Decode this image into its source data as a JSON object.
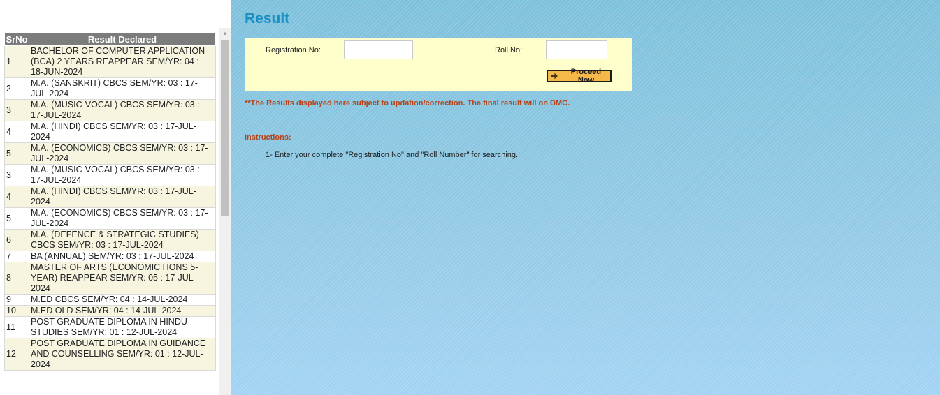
{
  "results_table": {
    "headers": {
      "srno": "SrNo",
      "result": "Result Declared"
    },
    "rows": [
      {
        "srno": "1",
        "result": "BACHELOR OF COMPUTER APPLICATION (BCA) 2 YEARS REAPPEAR SEM/YR: 04 : 18-JUN-2024"
      },
      {
        "srno": "2",
        "result": "M.A. (SANSKRIT) CBCS SEM/YR: 03 : 17-JUL-2024"
      },
      {
        "srno": "3",
        "result": "M.A. (MUSIC-VOCAL) CBCS SEM/YR: 03 : 17-JUL-2024"
      },
      {
        "srno": "4",
        "result": "M.A. (HINDI) CBCS SEM/YR: 03 : 17-JUL-2024"
      },
      {
        "srno": "5",
        "result": "M.A. (ECONOMICS) CBCS SEM/YR: 03 : 17-JUL-2024"
      },
      {
        "srno": "3",
        "result": "M.A. (MUSIC-VOCAL) CBCS SEM/YR: 03 : 17-JUL-2024"
      },
      {
        "srno": "4",
        "result": "M.A. (HINDI) CBCS SEM/YR: 03 : 17-JUL-2024"
      },
      {
        "srno": "5",
        "result": "M.A. (ECONOMICS) CBCS SEM/YR: 03 : 17-JUL-2024"
      },
      {
        "srno": "6",
        "result": "M.A. (DEFENCE & STRATEGIC STUDIES) CBCS SEM/YR: 03 : 17-JUL-2024"
      },
      {
        "srno": "7",
        "result": "BA (ANNUAL) SEM/YR: 03 : 17-JUL-2024"
      },
      {
        "srno": "8",
        "result": "MASTER OF ARTS (ECONOMIC HONS 5-YEAR) REAPPEAR SEM/YR: 05 : 17-JUL-2024"
      },
      {
        "srno": "9",
        "result": "M.ED CBCS SEM/YR: 04 : 14-JUL-2024"
      },
      {
        "srno": "10",
        "result": "M.ED OLD SEM/YR: 04 : 14-JUL-2024"
      },
      {
        "srno": "11",
        "result": "POST GRADUATE DIPLOMA IN HINDU STUDIES SEM/YR: 01 : 12-JUL-2024"
      },
      {
        "srno": "12",
        "result": "POST GRADUATE DIPLOMA IN GUIDANCE AND COUNSELLING SEM/YR: 01 : 12-JUL-2024"
      }
    ]
  },
  "page": {
    "title": "Result"
  },
  "form": {
    "registration_label": "Registration No:",
    "registration_value": "",
    "roll_label": "Roll No:",
    "roll_value": "",
    "proceed_label": "Proceed Now"
  },
  "note": "**The Results displayed here subject to updation/correction. The final result will on DMC.",
  "instructions": {
    "heading": "Instructions:",
    "items": [
      "1- Enter your complete \"Registration No\" and \"Roll Number\" for searching."
    ]
  },
  "colors": {
    "title": "#1a8fc2",
    "form_background": "#ffffcc",
    "button_background": "#f5b94a",
    "note_text": "#b6431a",
    "table_header": "#7c7c7c",
    "row_alternate": "#f7f5e0"
  },
  "icons": {
    "proceed": "arrow-right-icon",
    "scroll_up": "scroll-up-arrow-icon"
  }
}
